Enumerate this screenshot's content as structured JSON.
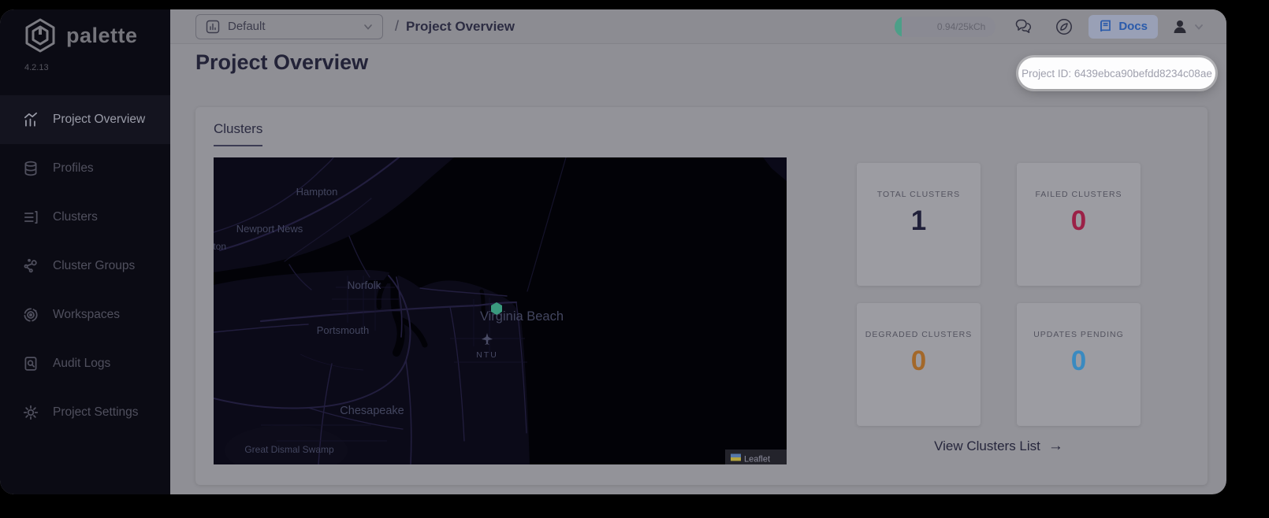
{
  "app": {
    "brand": "palette",
    "version": "4.2.13"
  },
  "sidebar": {
    "items": [
      {
        "label": "Project Overview",
        "icon": "chart-icon",
        "active": true
      },
      {
        "label": "Profiles",
        "icon": "database-icon",
        "active": false
      },
      {
        "label": "Clusters",
        "icon": "list-icon",
        "active": false
      },
      {
        "label": "Cluster Groups",
        "icon": "network-icon",
        "active": false
      },
      {
        "label": "Workspaces",
        "icon": "orbit-icon",
        "active": false
      },
      {
        "label": "Audit Logs",
        "icon": "doc-search-icon",
        "active": false
      },
      {
        "label": "Project Settings",
        "icon": "gear-icon",
        "active": false
      }
    ]
  },
  "topbar": {
    "project_selector": {
      "value": "Default"
    },
    "breadcrumb_sep": "/",
    "breadcrumb": "Project Overview",
    "usage_badge": "0.94/25kCh",
    "usage_fill_color": "#4c9f88",
    "docs_label": "Docs"
  },
  "tooltip": {
    "project_id": "Project ID: 6439ebca90befdd8234c08ae"
  },
  "page": {
    "title": "Project Overview"
  },
  "clusters_panel": {
    "tab_label": "Clusters",
    "view_link": "View Clusters List",
    "view_link_arrow": "→",
    "stats": [
      {
        "label": "Total Clusters",
        "value": "1",
        "color": "#20203a"
      },
      {
        "label": "Failed Clusters",
        "value": "0",
        "color": "#9b2147"
      },
      {
        "label": "Degraded Clusters",
        "value": "0",
        "color": "#a3682a"
      },
      {
        "label": "Updates Pending",
        "value": "0",
        "color": "#3a8ac0"
      }
    ]
  },
  "map": {
    "marker_color": "#3a9a7e",
    "labels": [
      {
        "text": "Hampton"
      },
      {
        "text": "Newport News"
      },
      {
        "text": "llton"
      },
      {
        "text": "Norfolk"
      },
      {
        "text": "Virginia Beach"
      },
      {
        "text": "Portsmouth"
      },
      {
        "text": "Chesapeake"
      },
      {
        "text": "Great Dismal Swamp"
      }
    ],
    "airport_code": "NTU",
    "attribution": "Leaflet"
  }
}
